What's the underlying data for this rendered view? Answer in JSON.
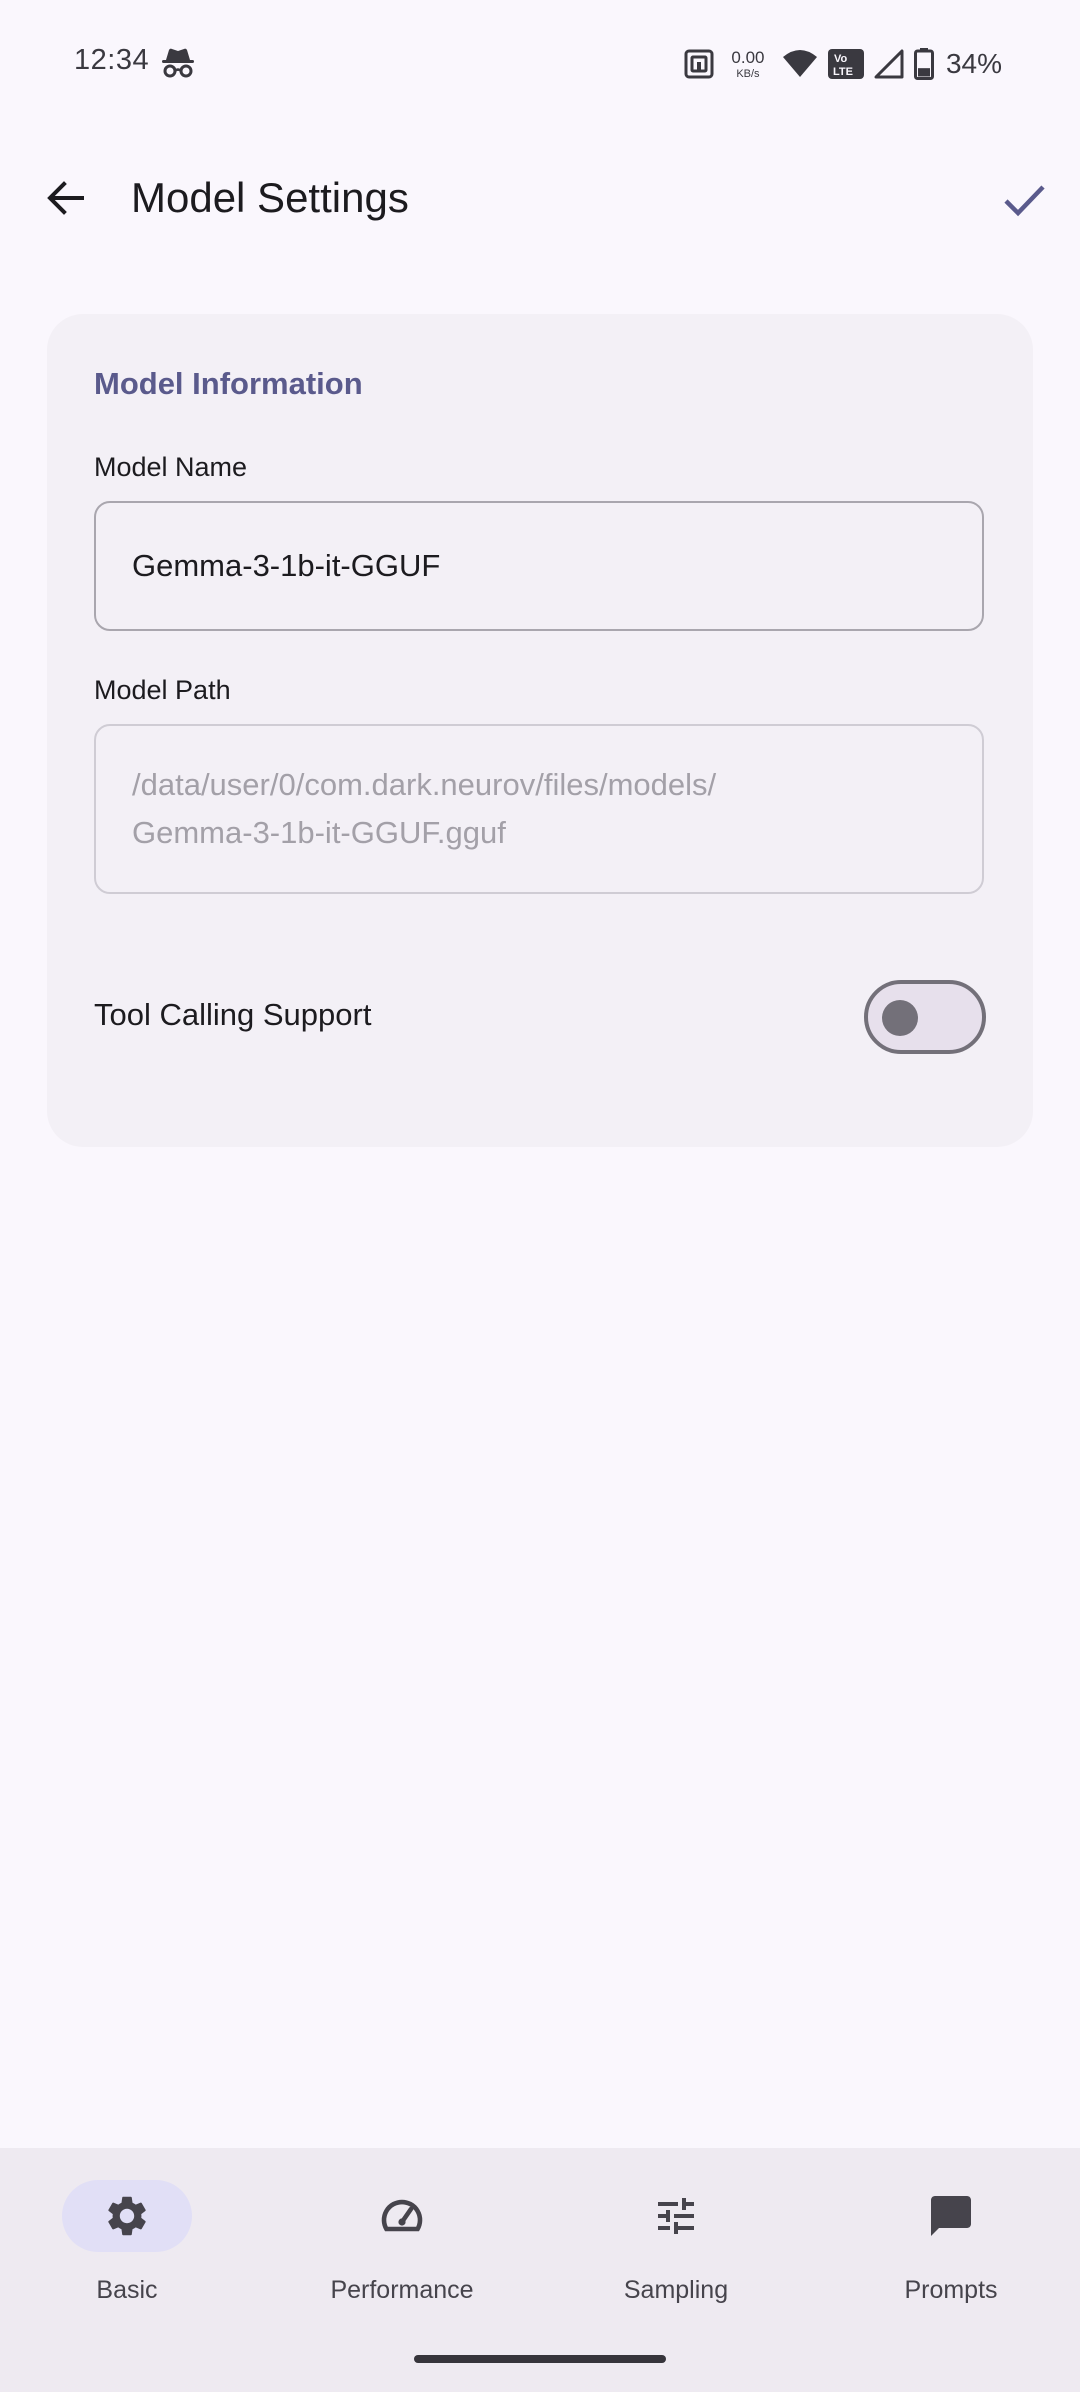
{
  "status_bar": {
    "time": "12:34",
    "net_speed_value": "0.00",
    "net_speed_unit": "KB/s",
    "volte_label": "Vo LTE",
    "battery_percent": "34%",
    "battery_level": 0.34,
    "icons": [
      "incognito-icon",
      "nfc-icon",
      "wifi-icon",
      "volte-icon",
      "signal-icon",
      "battery-icon"
    ]
  },
  "app_bar": {
    "title": "Model Settings",
    "back_icon": "arrow-back-icon",
    "save_icon": "check-icon"
  },
  "model_info": {
    "section_title": "Model Information",
    "name_label": "Model Name",
    "name_value": "Gemma-3-1b-it-GGUF",
    "path_label": "Model Path",
    "path_value": "/data/user/0/com.dark.neurov/files/models/\nGemma-3-1b-it-GGUF.gguf",
    "tool_calling_label": "Tool Calling Support",
    "tool_calling_enabled": false
  },
  "bottom_nav": {
    "items": [
      {
        "label": "Basic",
        "icon": "gear-icon",
        "selected": true
      },
      {
        "label": "Performance",
        "icon": "speedometer-icon",
        "selected": false
      },
      {
        "label": "Sampling",
        "icon": "sliders-icon",
        "selected": false
      },
      {
        "label": "Prompts",
        "icon": "chat-bubble-icon",
        "selected": false
      }
    ]
  },
  "colors": {
    "background": "#FAF7FD",
    "card": "#F3F0F6",
    "accent": "#5A5A8C",
    "nav_bar": "#EEEAF1",
    "nav_active_indicator": "#E1DFF6"
  }
}
